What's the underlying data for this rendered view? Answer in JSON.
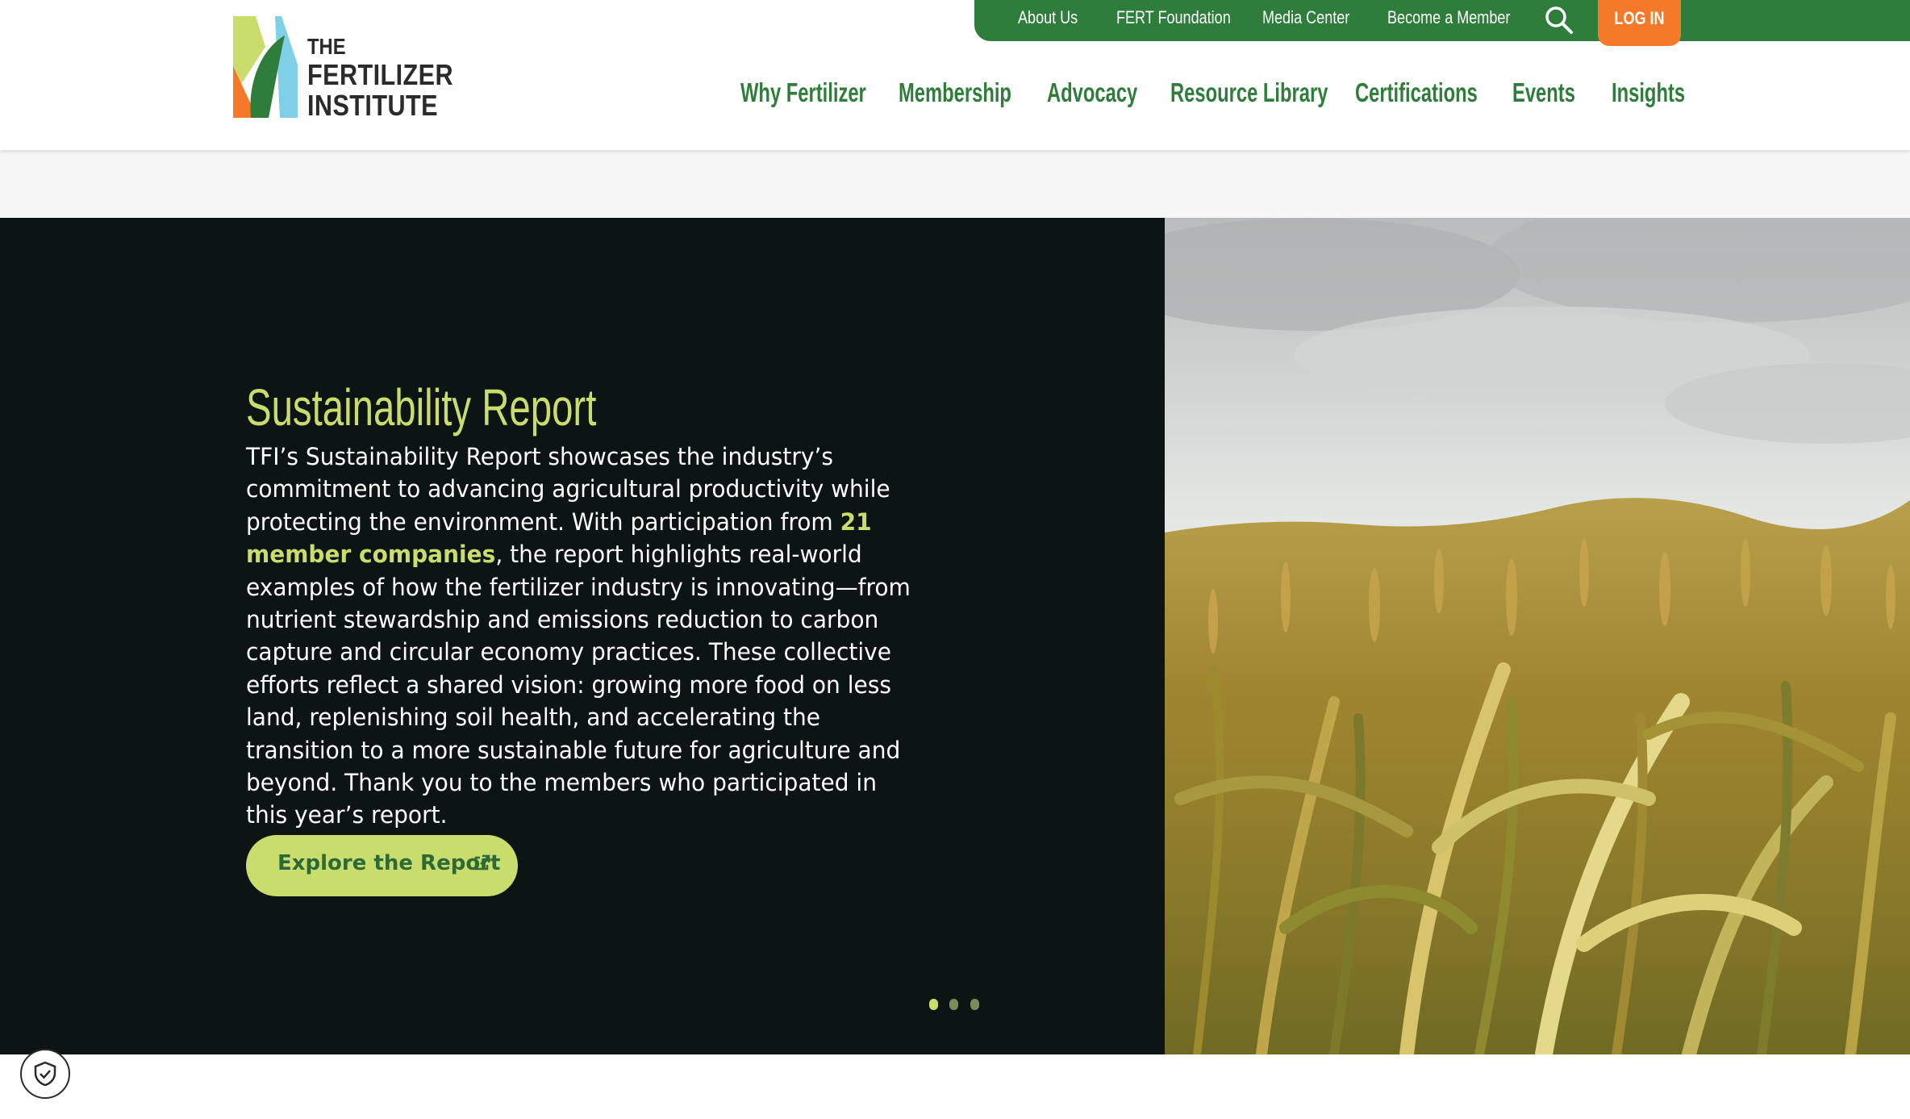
{
  "logo": {
    "line1": "THE",
    "line2": "FERTILIZER",
    "line3": "INSTITUTE"
  },
  "utility_nav": {
    "items": [
      "About Us",
      "FERT Foundation",
      "Media Center",
      "Become a Member"
    ],
    "search_icon": "search-icon",
    "login_label": "LOG IN"
  },
  "main_nav": {
    "items": [
      "Why Fertilizer",
      "Membership",
      "Advocacy",
      "Resource Library",
      "Certifications",
      "Events",
      "Insights"
    ]
  },
  "hero": {
    "title": "Sustainability Report",
    "text_before": "TFI’s Sustainability Report showcases the industry’s commitment to advancing agricultural productivity while protecting the environment. With participation from ",
    "highlight": "21 member companies",
    "text_after": ", the report highlights real-world examples of how the fertilizer industry is innovating—from nutrient stewardship and emissions reduction to carbon capture and circular economy practices. These collective efforts reflect a shared vision: growing more food on less land, replenishing soil health, and accelerating the transition to a more sustainable future for agriculture and beyond. Thank you to the members who participated in this year’s report.",
    "cta_label": "Explore the Report",
    "cta_icon": "external-link-icon",
    "slides_total": 3,
    "active_slide": 1
  },
  "colors": {
    "brand_green": "#2e7d3a",
    "accent_lime": "#c8dd6b",
    "login_orange": "#f47a2a",
    "hero_bg": "#0d1414"
  },
  "privacy_icon": "shield-check-icon"
}
